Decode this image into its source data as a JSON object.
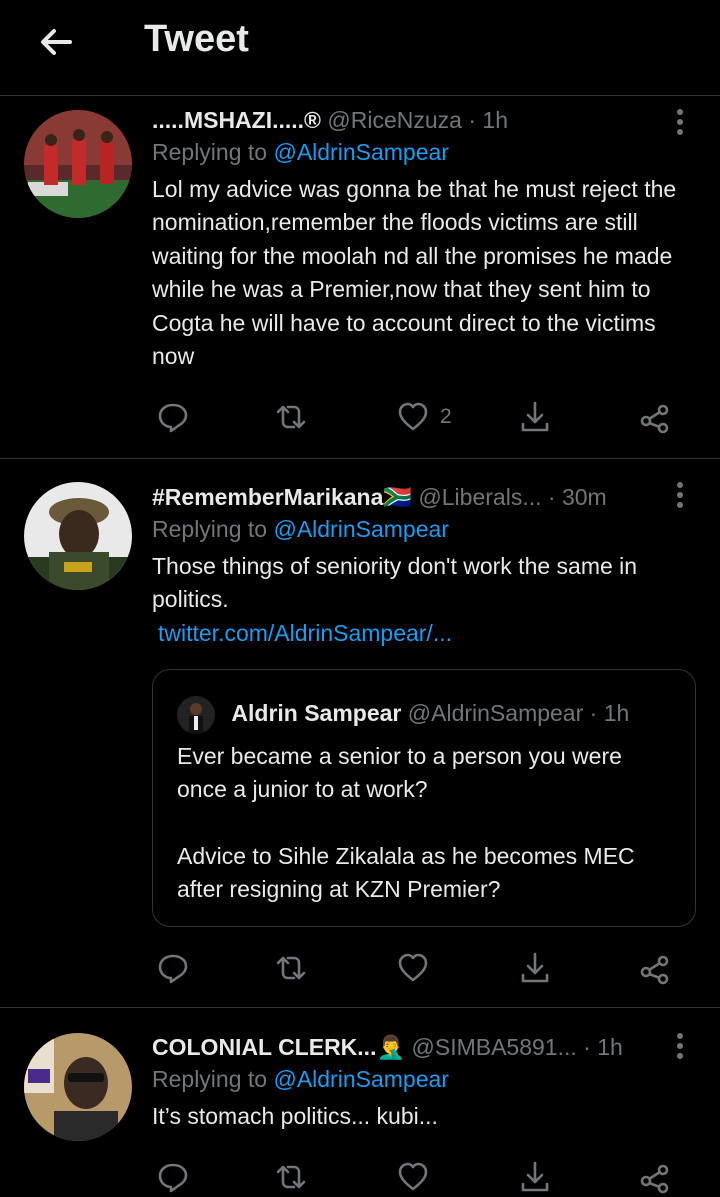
{
  "header": {
    "title": "Tweet"
  },
  "tweets": [
    {
      "name": ".....MSHAZI.....®",
      "handle": "@RiceNzuza",
      "time": "· 1h",
      "replying_prefix": "Replying to ",
      "replying_handle": "@AldrinSampear",
      "text": "Lol my advice was gonna be that he must reject the nomination,remember the floods victims are still waiting for the moolah nd all the promises he made while he was a Premier,now that they sent him to Cogta he will have to account direct to the victims now",
      "likes": "2"
    },
    {
      "name": "#RememberMarikana🇿🇦",
      "handle": "@Liberals...",
      "time": "· 30m",
      "replying_prefix": "Replying to ",
      "replying_handle": "@AldrinSampear",
      "text": "Those things of seniority don't work the same in politics.",
      "link": "twitter.com/AldrinSampear/...",
      "quote": {
        "name": "Aldrin Sampear",
        "handle": "@AldrinSampear",
        "time": "· 1h",
        "text_1": "Ever became a senior to a person you were once a junior to at work?",
        "text_2": "Advice to Sihle Zikalala as he becomes MEC after resigning at KZN Premier?"
      }
    },
    {
      "name": "COLONIAL CLERK...🤦‍♂️",
      "handle": "@SIMBA5891...",
      "time": "· 1h",
      "replying_prefix": "Replying to ",
      "replying_handle": "@AldrinSampear",
      "text": "It’s stomach politics... kubi..."
    }
  ],
  "colors": {
    "accent": "#1d9bf0",
    "muted": "#71767b",
    "text": "#e7e9ea",
    "divider": "#2f3336"
  }
}
